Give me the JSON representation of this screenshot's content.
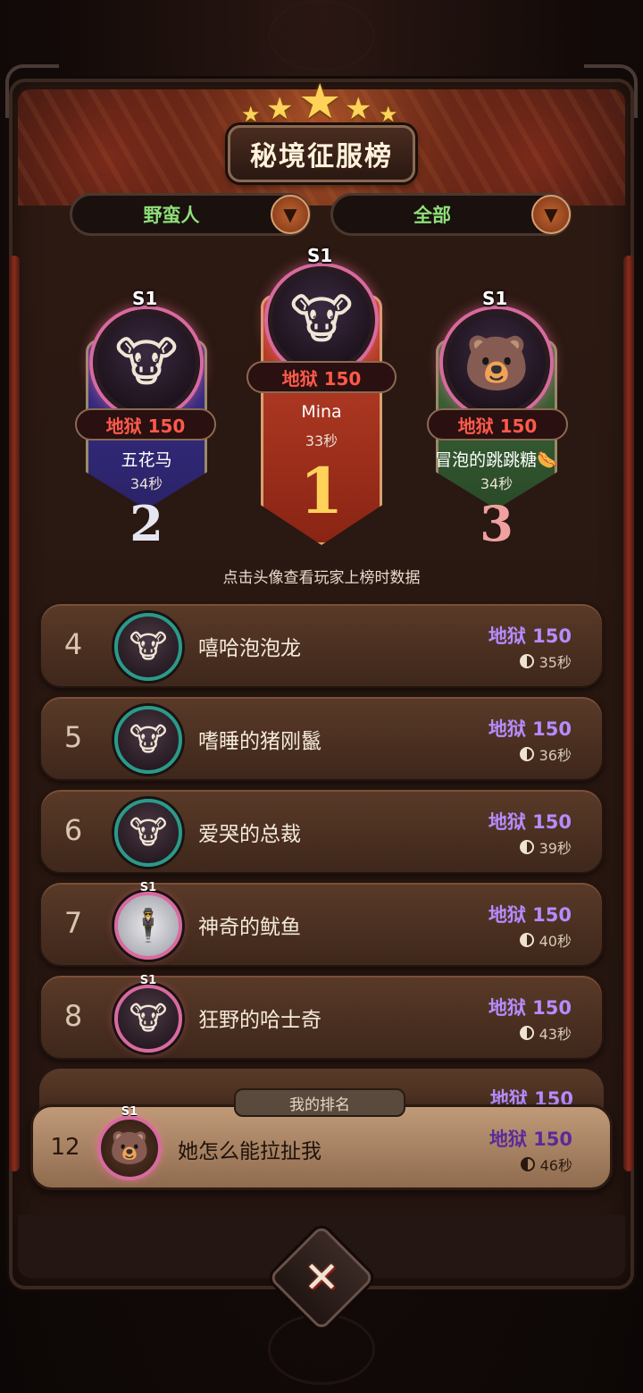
{
  "title": "秘境征服榜",
  "filters": [
    {
      "label": "野蛮人"
    },
    {
      "label": "全部"
    }
  ],
  "podium": {
    "first": {
      "season": "S1",
      "difficulty": "地狱 150",
      "name": "Mina",
      "time": "33秒",
      "rank": "1"
    },
    "second": {
      "season": "S1",
      "difficulty": "地狱 150",
      "name": "五花马",
      "time": "34秒",
      "rank": "2"
    },
    "third": {
      "season": "S1",
      "difficulty": "地狱 150",
      "name": "冒泡的跳跳糖🌭",
      "time": "34秒",
      "rank": "3"
    }
  },
  "hint": "点击头像查看玩家上榜时数据",
  "rows": [
    {
      "rank": "4",
      "name": "嘻哈泡泡龙",
      "difficulty": "地狱 150",
      "time": "35秒"
    },
    {
      "rank": "5",
      "name": "嗜睡的猪刚鬣",
      "difficulty": "地狱 150",
      "time": "36秒"
    },
    {
      "rank": "6",
      "name": "爱哭的总裁",
      "difficulty": "地狱 150",
      "time": "39秒"
    },
    {
      "rank": "7",
      "name": "神奇的鱿鱼",
      "difficulty": "地狱 150",
      "time": "40秒",
      "season": "S1"
    },
    {
      "rank": "8",
      "name": "狂野的哈士奇",
      "difficulty": "地狱 150",
      "time": "43秒",
      "season": "S1"
    }
  ],
  "partial_row": {
    "difficulty": "地狱 150"
  },
  "my_rank": {
    "tag": "我的排名",
    "rank": "12",
    "season": "S1",
    "name": "她怎么能拉扯我",
    "difficulty": "地狱 150",
    "time": "46秒"
  },
  "icons": {
    "close": "close-x-icon",
    "dropdown": "chevron-down-icon",
    "clock": "clock-icon",
    "star": "star-icon"
  },
  "colors": {
    "difficulty_purple": "#b58cff",
    "difficulty_red": "#ff5a4a",
    "filter_green": "#8ee07a",
    "rank1_red": "#c0432a",
    "rank2_blue": "#3a2f8a",
    "rank3_green": "#3f6a3a"
  }
}
